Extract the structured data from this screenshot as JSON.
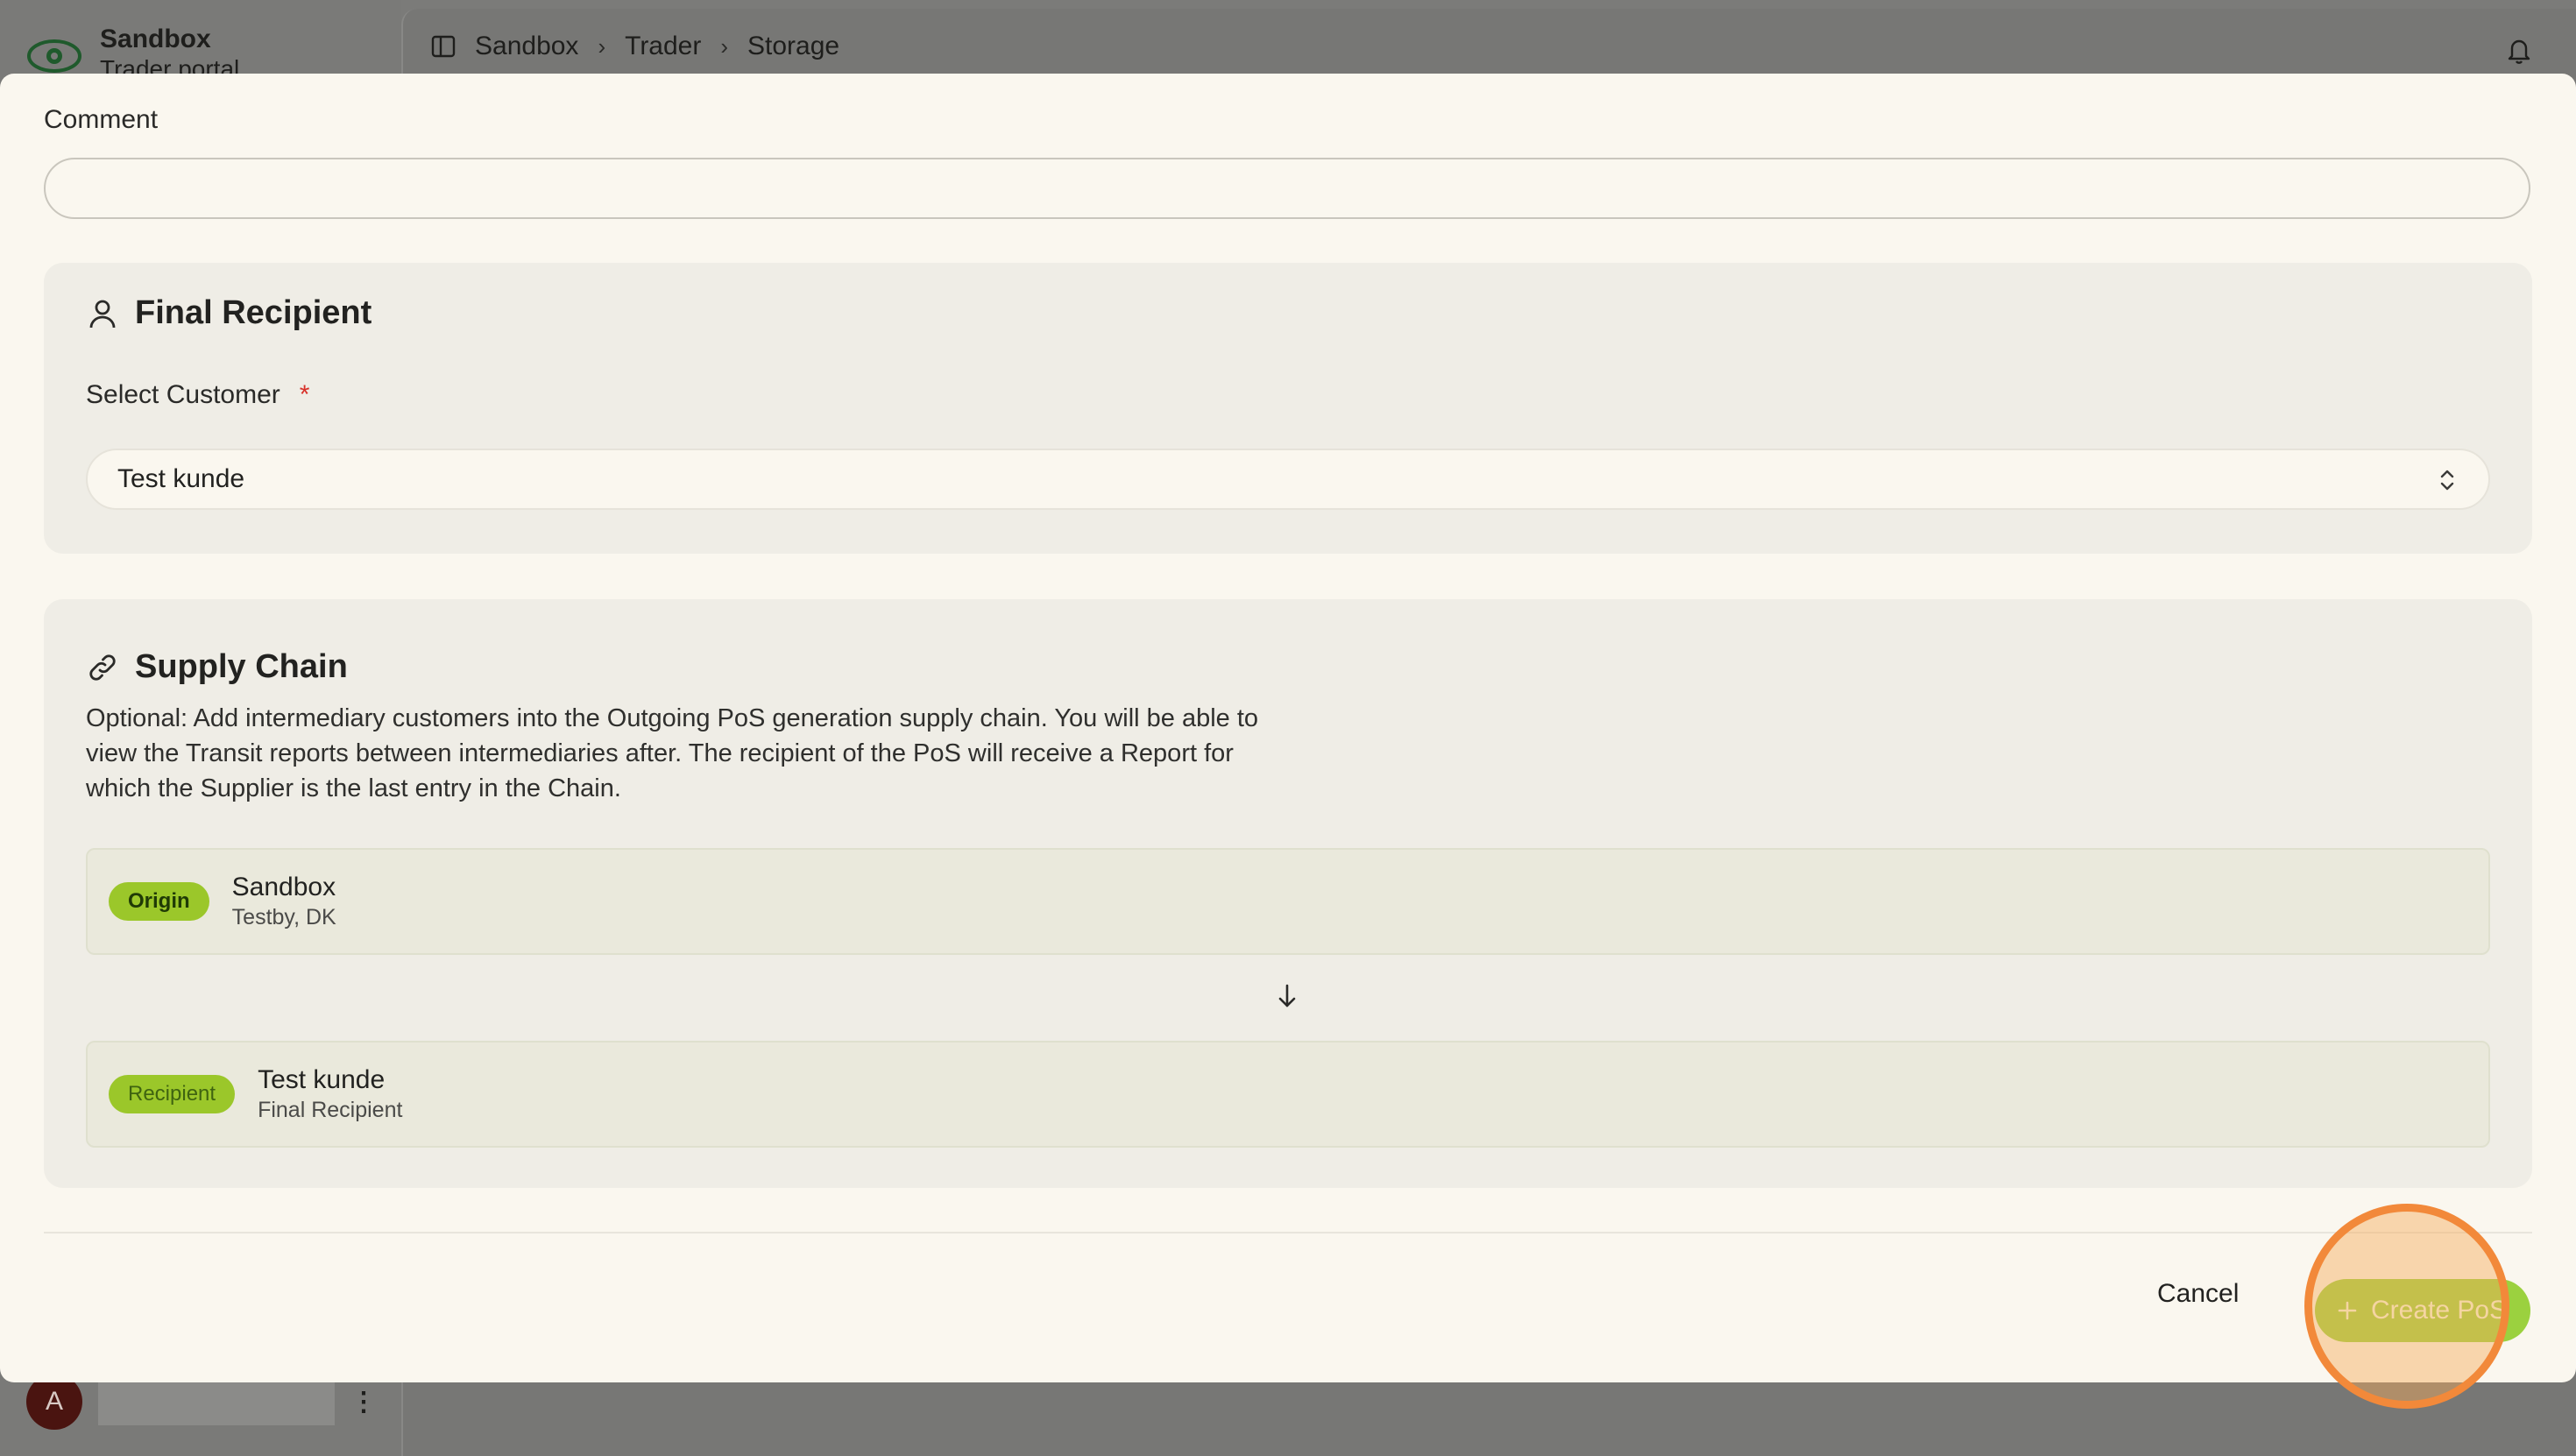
{
  "brand": {
    "title": "Sandbox",
    "subtitle": "Trader portal"
  },
  "breadcrumb": [
    "Sandbox",
    "Trader",
    "Storage"
  ],
  "user": {
    "initial": "A"
  },
  "modal": {
    "comment": {
      "label": "Comment",
      "value": "",
      "placeholder": ""
    },
    "final_recipient": {
      "title": "Final Recipient",
      "select_label": "Select Customer",
      "required_mark": "*",
      "selected_customer": "Test kunde"
    },
    "supply_chain": {
      "title": "Supply Chain",
      "description": "Optional: Add intermediary customers into the Outgoing PoS generation supply chain. You will be able to view the Transit reports between intermediaries after. The recipient of the PoS will receive a Report for which the Supplier is the last entry in the Chain.",
      "origin": {
        "badge": "Origin",
        "name": "Sandbox",
        "location": "Testby, DK"
      },
      "recipient": {
        "badge": "Recipient",
        "name": "Test kunde",
        "role": "Final Recipient"
      }
    },
    "actions": {
      "cancel": "Cancel",
      "create": "Create PoS"
    }
  },
  "colors": {
    "accent_green": "#9bd13f",
    "badge_green": "#9bc72a",
    "required_red": "#d8312a",
    "highlight_orange": "#f2893a"
  }
}
